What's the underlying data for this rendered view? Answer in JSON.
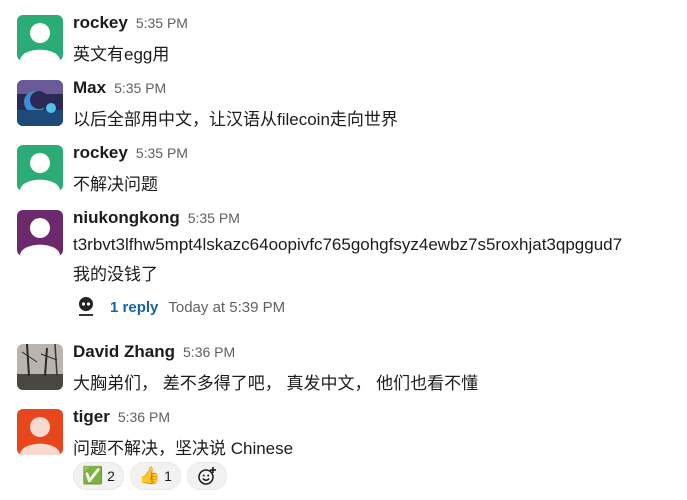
{
  "messages": [
    {
      "author": "rockey",
      "time": "5:35 PM",
      "lines": [
        "英文有egg用"
      ],
      "avatar": "default-green"
    },
    {
      "author": "Max",
      "time": "5:35 PM",
      "lines": [
        "以后全部用中文，让汉语从filecoin走向世界"
      ],
      "avatar": "photo-night"
    },
    {
      "author": "rockey",
      "time": "5:35 PM",
      "lines": [
        "不解决问题"
      ],
      "avatar": "default-green"
    },
    {
      "author": "niukongkong",
      "time": "5:35 PM",
      "lines": [
        "t3rbvt3lfhw5mpt4lskazc64oopivfc765gohgfsyz4ewbz7s5roxhjat3qpggud7",
        "我的没钱了"
      ],
      "avatar": "default-purple",
      "thread": {
        "reply_label": "1 reply",
        "reply_time": "Today at 5:39 PM"
      }
    },
    {
      "author": "David Zhang",
      "time": "5:36 PM",
      "lines": [
        "大胸弟们，  差不多得了吧，  真发中文，  他们也看不懂"
      ],
      "avatar": "photo-trees"
    },
    {
      "author": "tiger",
      "time": "5:36 PM",
      "lines": [
        "问题不解决，坚决说 Chinese"
      ],
      "avatar": "default-orange",
      "reactions": [
        {
          "emoji": "✅",
          "count": "2"
        },
        {
          "emoji": "👍",
          "count": "1"
        }
      ]
    }
  ],
  "colors": {
    "green": "#2bac76",
    "purple": "#6c2a6c",
    "orange": "#e8471d",
    "link": "#1264a3"
  }
}
